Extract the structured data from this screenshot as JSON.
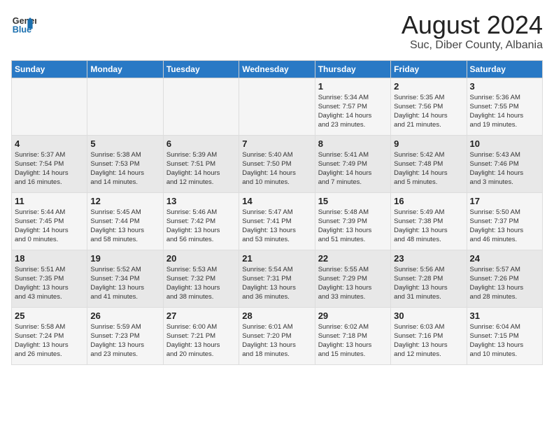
{
  "logo": {
    "line1": "General",
    "line2": "Blue"
  },
  "title": "August 2024",
  "subtitle": "Suc, Diber County, Albania",
  "weekdays": [
    "Sunday",
    "Monday",
    "Tuesday",
    "Wednesday",
    "Thursday",
    "Friday",
    "Saturday"
  ],
  "weeks": [
    [
      {
        "day": "",
        "info": ""
      },
      {
        "day": "",
        "info": ""
      },
      {
        "day": "",
        "info": ""
      },
      {
        "day": "",
        "info": ""
      },
      {
        "day": "1",
        "info": "Sunrise: 5:34 AM\nSunset: 7:57 PM\nDaylight: 14 hours\nand 23 minutes."
      },
      {
        "day": "2",
        "info": "Sunrise: 5:35 AM\nSunset: 7:56 PM\nDaylight: 14 hours\nand 21 minutes."
      },
      {
        "day": "3",
        "info": "Sunrise: 5:36 AM\nSunset: 7:55 PM\nDaylight: 14 hours\nand 19 minutes."
      }
    ],
    [
      {
        "day": "4",
        "info": "Sunrise: 5:37 AM\nSunset: 7:54 PM\nDaylight: 14 hours\nand 16 minutes."
      },
      {
        "day": "5",
        "info": "Sunrise: 5:38 AM\nSunset: 7:53 PM\nDaylight: 14 hours\nand 14 minutes."
      },
      {
        "day": "6",
        "info": "Sunrise: 5:39 AM\nSunset: 7:51 PM\nDaylight: 14 hours\nand 12 minutes."
      },
      {
        "day": "7",
        "info": "Sunrise: 5:40 AM\nSunset: 7:50 PM\nDaylight: 14 hours\nand 10 minutes."
      },
      {
        "day": "8",
        "info": "Sunrise: 5:41 AM\nSunset: 7:49 PM\nDaylight: 14 hours\nand 7 minutes."
      },
      {
        "day": "9",
        "info": "Sunrise: 5:42 AM\nSunset: 7:48 PM\nDaylight: 14 hours\nand 5 minutes."
      },
      {
        "day": "10",
        "info": "Sunrise: 5:43 AM\nSunset: 7:46 PM\nDaylight: 14 hours\nand 3 minutes."
      }
    ],
    [
      {
        "day": "11",
        "info": "Sunrise: 5:44 AM\nSunset: 7:45 PM\nDaylight: 14 hours\nand 0 minutes."
      },
      {
        "day": "12",
        "info": "Sunrise: 5:45 AM\nSunset: 7:44 PM\nDaylight: 13 hours\nand 58 minutes."
      },
      {
        "day": "13",
        "info": "Sunrise: 5:46 AM\nSunset: 7:42 PM\nDaylight: 13 hours\nand 56 minutes."
      },
      {
        "day": "14",
        "info": "Sunrise: 5:47 AM\nSunset: 7:41 PM\nDaylight: 13 hours\nand 53 minutes."
      },
      {
        "day": "15",
        "info": "Sunrise: 5:48 AM\nSunset: 7:39 PM\nDaylight: 13 hours\nand 51 minutes."
      },
      {
        "day": "16",
        "info": "Sunrise: 5:49 AM\nSunset: 7:38 PM\nDaylight: 13 hours\nand 48 minutes."
      },
      {
        "day": "17",
        "info": "Sunrise: 5:50 AM\nSunset: 7:37 PM\nDaylight: 13 hours\nand 46 minutes."
      }
    ],
    [
      {
        "day": "18",
        "info": "Sunrise: 5:51 AM\nSunset: 7:35 PM\nDaylight: 13 hours\nand 43 minutes."
      },
      {
        "day": "19",
        "info": "Sunrise: 5:52 AM\nSunset: 7:34 PM\nDaylight: 13 hours\nand 41 minutes."
      },
      {
        "day": "20",
        "info": "Sunrise: 5:53 AM\nSunset: 7:32 PM\nDaylight: 13 hours\nand 38 minutes."
      },
      {
        "day": "21",
        "info": "Sunrise: 5:54 AM\nSunset: 7:31 PM\nDaylight: 13 hours\nand 36 minutes."
      },
      {
        "day": "22",
        "info": "Sunrise: 5:55 AM\nSunset: 7:29 PM\nDaylight: 13 hours\nand 33 minutes."
      },
      {
        "day": "23",
        "info": "Sunrise: 5:56 AM\nSunset: 7:28 PM\nDaylight: 13 hours\nand 31 minutes."
      },
      {
        "day": "24",
        "info": "Sunrise: 5:57 AM\nSunset: 7:26 PM\nDaylight: 13 hours\nand 28 minutes."
      }
    ],
    [
      {
        "day": "25",
        "info": "Sunrise: 5:58 AM\nSunset: 7:24 PM\nDaylight: 13 hours\nand 26 minutes."
      },
      {
        "day": "26",
        "info": "Sunrise: 5:59 AM\nSunset: 7:23 PM\nDaylight: 13 hours\nand 23 minutes."
      },
      {
        "day": "27",
        "info": "Sunrise: 6:00 AM\nSunset: 7:21 PM\nDaylight: 13 hours\nand 20 minutes."
      },
      {
        "day": "28",
        "info": "Sunrise: 6:01 AM\nSunset: 7:20 PM\nDaylight: 13 hours\nand 18 minutes."
      },
      {
        "day": "29",
        "info": "Sunrise: 6:02 AM\nSunset: 7:18 PM\nDaylight: 13 hours\nand 15 minutes."
      },
      {
        "day": "30",
        "info": "Sunrise: 6:03 AM\nSunset: 7:16 PM\nDaylight: 13 hours\nand 12 minutes."
      },
      {
        "day": "31",
        "info": "Sunrise: 6:04 AM\nSunset: 7:15 PM\nDaylight: 13 hours\nand 10 minutes."
      }
    ]
  ]
}
